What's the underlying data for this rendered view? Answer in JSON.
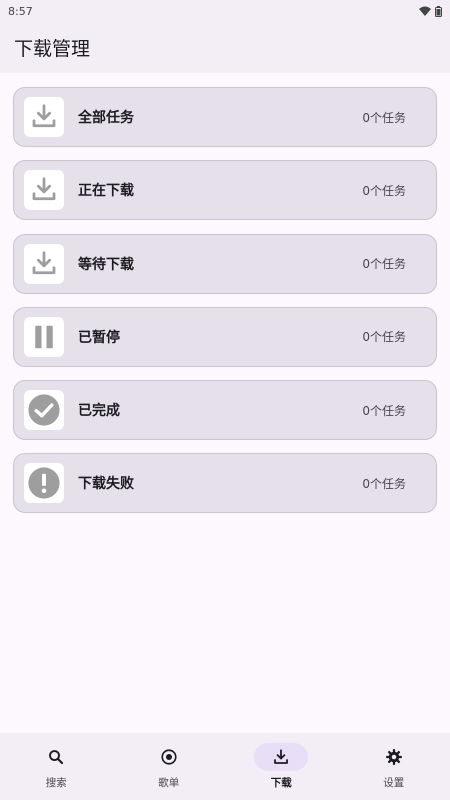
{
  "status_bar": {
    "time": "8:57",
    "wifi_icon": "wifi-icon",
    "battery_icon": "battery-icon"
  },
  "app_bar": {
    "title": "下载管理"
  },
  "items": [
    {
      "label": "全部任务",
      "count": "0个任务",
      "icon": "download-icon"
    },
    {
      "label": "正在下载",
      "count": "0个任务",
      "icon": "download-icon"
    },
    {
      "label": "等待下载",
      "count": "0个任务",
      "icon": "download-icon"
    },
    {
      "label": "已暂停",
      "count": "0个任务",
      "icon": "pause-icon"
    },
    {
      "label": "已完成",
      "count": "0个任务",
      "icon": "check-circle-icon"
    },
    {
      "label": "下载失败",
      "count": "0个任务",
      "icon": "error-icon"
    }
  ],
  "bottom_nav": [
    {
      "label": "搜索",
      "icon": "search-icon",
      "active": false
    },
    {
      "label": "歌单",
      "icon": "playlist-icon",
      "active": false
    },
    {
      "label": "下载",
      "icon": "download-icon",
      "active": true
    },
    {
      "label": "设置",
      "icon": "gear-icon",
      "active": false
    }
  ],
  "colors": {
    "background": "#fdf8fd",
    "surface": "#f3eef6",
    "card": "#e6e0ea",
    "icon_gray": "#9e9e9e",
    "active_pill": "#e8def8"
  }
}
